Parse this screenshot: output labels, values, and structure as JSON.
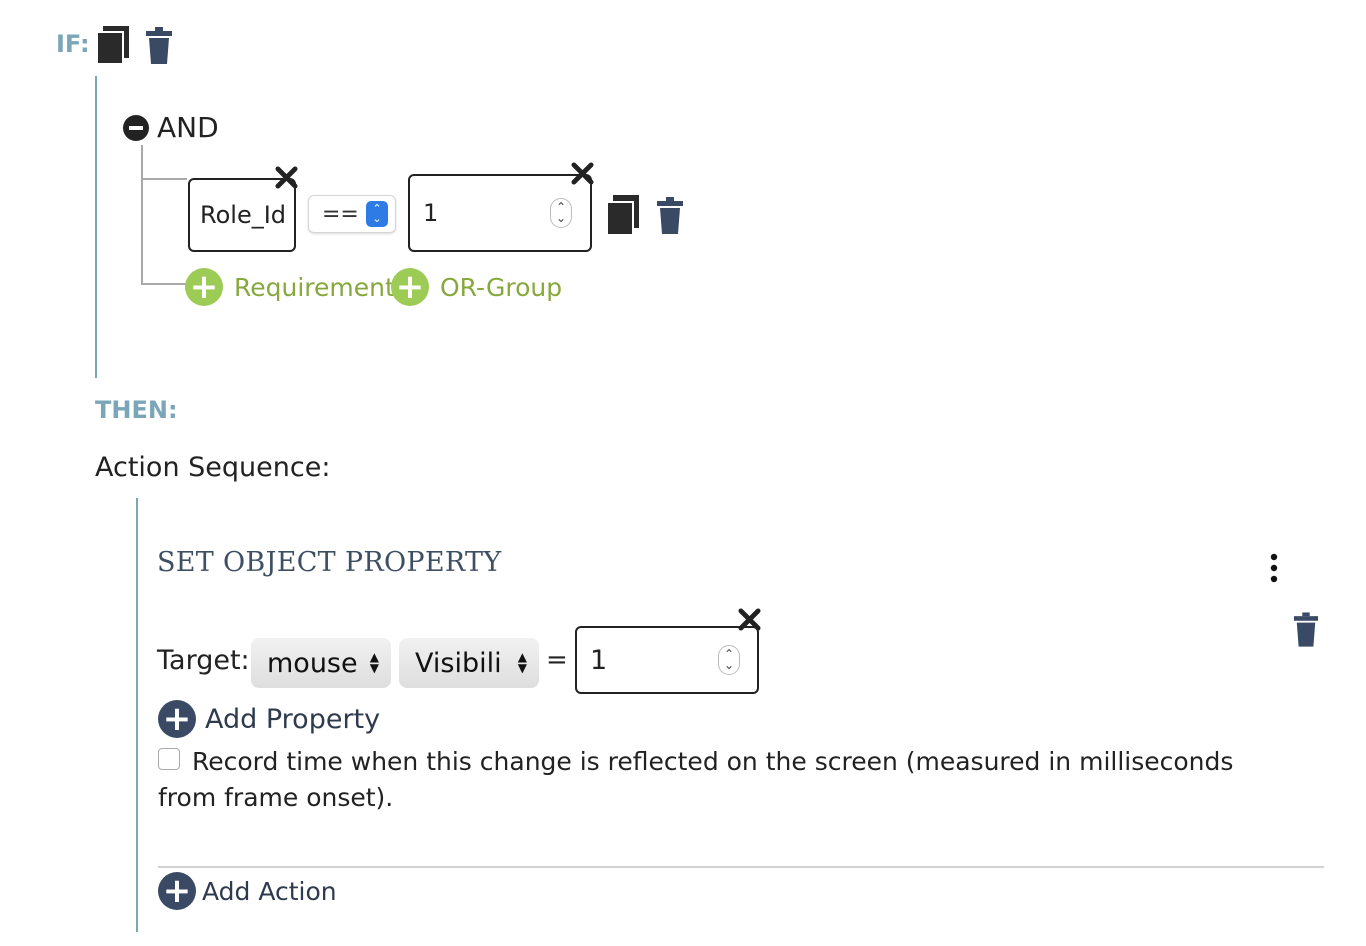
{
  "condition": {
    "if_label": "IF:",
    "group": {
      "operator_label": "AND",
      "requirement": {
        "field_value": "Role_Id",
        "operator_value": "==",
        "compare_value": "1"
      },
      "add_requirement_label": "Requirement",
      "add_or_group_label": "OR-Group"
    }
  },
  "then_label": "THEN:",
  "action_sequence": {
    "label": "Action Sequence:",
    "action": {
      "title": "SET OBJECT PROPERTY",
      "target_label": "Target:",
      "object_value": "mouse",
      "property_value": "Visibili",
      "equals_label": "=",
      "property_input_value": "1",
      "add_property_label": "Add Property",
      "record_time_text": "Record time when this change is reflected on the screen (measured in milliseconds from frame onset)."
    },
    "add_action_label": "Add Action"
  },
  "colors": {
    "accent_teal": "#7aa6b8",
    "add_green": "#9ccc56",
    "navy": "#3a4a65",
    "select_blue": "#2f7be6"
  },
  "icons": [
    "copy-icon",
    "trash-icon",
    "minus-circle-icon",
    "close-icon",
    "plus-circle-icon",
    "vertical-dots-icon",
    "chevron-updown-icon"
  ]
}
